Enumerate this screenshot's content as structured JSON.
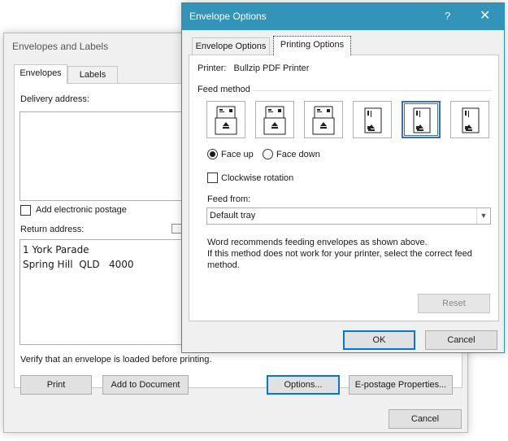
{
  "envelopes_labels": {
    "title": "Envelopes and Labels",
    "tabs": [
      {
        "label": "Envelopes"
      },
      {
        "label": "Labels"
      }
    ],
    "delivery_label": "Delivery address:",
    "delivery_value": "",
    "electronic_postage_label": "Add electronic postage",
    "return_label": "Return address:",
    "return_address_line1": "1 York Parade",
    "return_address_line2": "Spring Hill  QLD   4000",
    "verify_text": "Verify that an envelope is loaded before printing.",
    "print_label": "Print",
    "add_to_document_label": "Add to Document",
    "options_label": "Options...",
    "epostage_label": "E-postage Properties...",
    "cancel_label": "Cancel"
  },
  "envelope_options": {
    "title": "Envelope Options",
    "help_glyph": "?",
    "close_glyph": "✕",
    "tabs": [
      {
        "label": "Envelope Options"
      },
      {
        "label": "Printing Options"
      }
    ],
    "printer_label": "Printer:",
    "printer_name": "Bullzip PDF Printer",
    "feed_method_label": "Feed method",
    "face_up_label": "Face up",
    "face_down_label": "Face down",
    "face_up_selected": true,
    "clockwise_label": "Clockwise rotation",
    "clockwise_checked": false,
    "feed_from_label": "Feed from:",
    "feed_from_value": "Default tray",
    "recommend_line1": "Word recommends feeding envelopes as shown above.",
    "recommend_line2": "If this method does not work for your printer, select the correct feed",
    "recommend_line3": "method.",
    "reset_label": "Reset",
    "ok_label": "OK",
    "cancel_label": "Cancel",
    "accent_color": "#3294b8",
    "selected_feed_index": 4
  }
}
